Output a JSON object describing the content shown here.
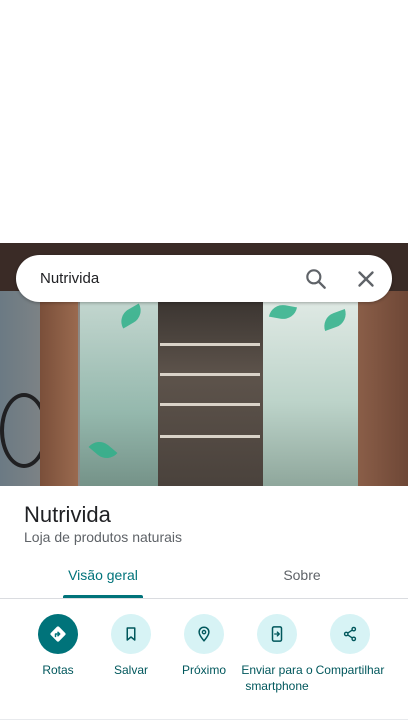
{
  "search": {
    "query": "Nutrivida"
  },
  "place": {
    "name": "Nutrivida",
    "category": "Loja de produtos naturais"
  },
  "tabs": [
    {
      "label": "Visão geral",
      "active": true
    },
    {
      "label": "Sobre",
      "active": false
    }
  ],
  "actions": [
    {
      "label": "Rotas",
      "icon": "directions-icon"
    },
    {
      "label": "Salvar",
      "icon": "bookmark-icon"
    },
    {
      "label": "Próximo",
      "icon": "nearby-icon"
    },
    {
      "label": "Enviar para o smartphone",
      "icon": "send-to-phone-icon"
    },
    {
      "label": "Compartilhar",
      "icon": "share-icon"
    }
  ],
  "colors": {
    "accent": "#00737a",
    "accent_light": "#d7f3f5"
  }
}
